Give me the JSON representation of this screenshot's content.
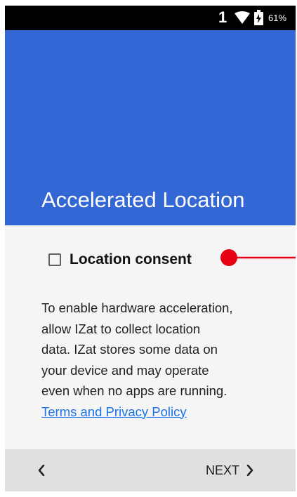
{
  "status_bar": {
    "notification_count": "1",
    "battery_percent": "61%",
    "wifi_icon": "wifi-icon",
    "battery_icon": "battery-icon"
  },
  "header": {
    "title": "Accelerated Location",
    "background_color": "#3367d6"
  },
  "consent": {
    "label": "Location consent",
    "checked": false
  },
  "description": {
    "lines": [
      "To enable hardware acceleration,",
      "allow IZat to collect location",
      "data. IZat stores some data on",
      "your device and may operate",
      "even when no apps are running."
    ],
    "link_text": "Terms and Privacy Policy"
  },
  "navigation": {
    "back_icon": "chevron-left-icon",
    "next_label": "NEXT",
    "next_icon": "chevron-right-icon"
  },
  "annotation": {
    "marker_color": "#e60012"
  }
}
